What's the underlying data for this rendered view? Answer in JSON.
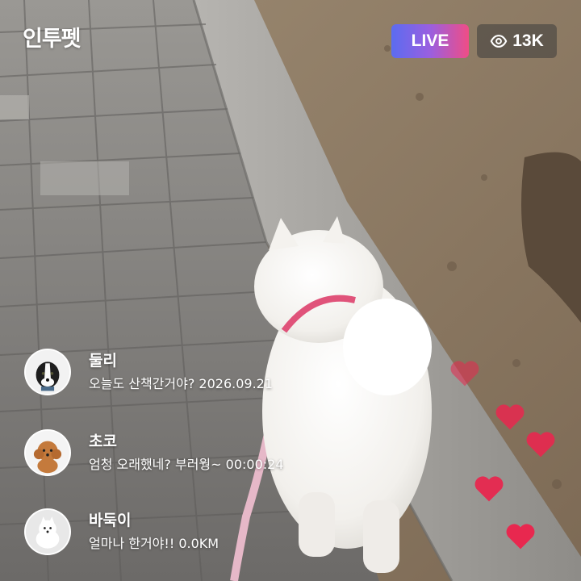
{
  "app": {
    "brand": "인투펫"
  },
  "stream": {
    "live_label": "LIVE",
    "viewer_count": "13K",
    "viewer_icon": "eye-icon"
  },
  "comments": [
    {
      "name": "둘리",
      "message": "오늘도 산책간거야? 2026.09.21",
      "avatar": "border-collie-avatar"
    },
    {
      "name": "초코",
      "message": "엄청 오래했네? 부러웡~ 00:00:24",
      "avatar": "poodle-avatar"
    },
    {
      "name": "바둑이",
      "message": "얼마나 한거야!! 0.0KM",
      "avatar": "spitz-avatar"
    }
  ],
  "colors": {
    "live_gradient": [
      "#5b6cf0",
      "#9a5fe0",
      "#ef4d86"
    ],
    "heart": "#e8284f",
    "viewer_badge_bg": "rgba(60,60,60,0.55)"
  }
}
